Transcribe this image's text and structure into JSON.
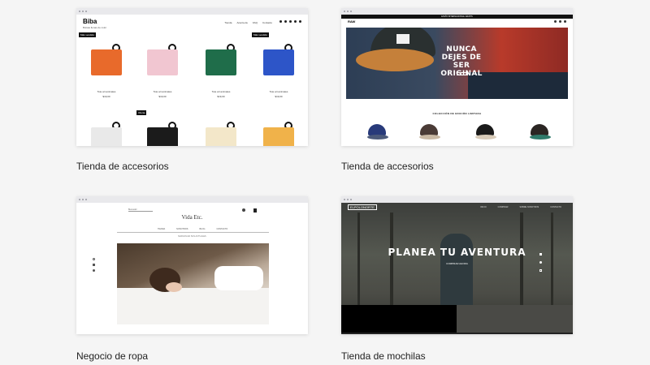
{
  "templates": [
    {
      "caption": "Tienda de accesorios",
      "site": {
        "logo": "Biba",
        "tagline": "Bolsas llenas de color",
        "nav": [
          "Tienda",
          "Acerca de",
          "FAQ",
          "Contacto"
        ],
        "badges": [
          "Más vendido",
          "Más vendido",
          "Oferta"
        ],
        "product_label": "Tote art animales",
        "product_price": "$19,00"
      }
    },
    {
      "caption": "Tienda de accesorios",
      "site": {
        "announcement": "ENVÍO INTERNACIONAL GRATIS",
        "logo": "RAW",
        "hero_title": "NUNCA DEJES DE SER ORIGINAL",
        "collection_label": "COLECCIÓN DE EDICIÓN LIMITADA"
      }
    },
    {
      "caption": "Negocio de ropa",
      "site": {
        "search_placeholder": "Buscador",
        "title": "Vida Etc.",
        "nav": [
          "TIENDA",
          "NOSOTROS",
          "BLOG",
          "CONTACTO"
        ],
        "subtitle": "MARCAS EN SUS ACTUALES"
      }
    },
    {
      "caption": "Tienda de mochilas",
      "site": {
        "logo": "ELPOLONORTE",
        "nav": [
          "INICIO",
          "COMPRAR",
          "SOBRE NOSOTROS",
          "CONTACTO"
        ],
        "hero_title": "PLANEA TU AVENTURA",
        "cta": "COMPRAR AHORA"
      }
    }
  ],
  "colors": {
    "page_bg": "#f5f5f5",
    "caption_text": "#222222",
    "browser_bar": "#e9e9ec"
  }
}
